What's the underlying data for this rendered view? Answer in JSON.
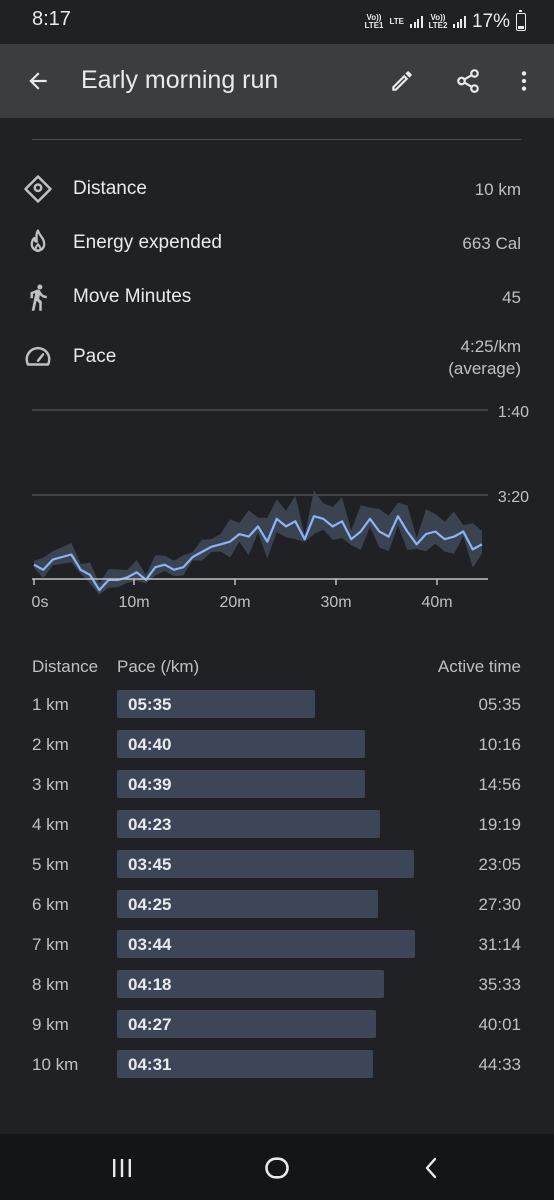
{
  "status_bar": {
    "time": "8:17",
    "net1": "Vo)) LTE1",
    "net_lte": "LTE",
    "net2": "Vo)) LTE2",
    "battery": "17%"
  },
  "app_bar": {
    "title": "Early morning run",
    "icons": [
      "back-arrow-icon",
      "edit-pencil-icon",
      "share-icon",
      "more-vert-icon"
    ]
  },
  "stats": [
    {
      "icon": "location-pin-icon",
      "label": "Distance",
      "value": "10 km"
    },
    {
      "icon": "fire-icon",
      "label": "Energy expended",
      "value": "663 Cal"
    },
    {
      "icon": "walking-icon",
      "label": "Move Minutes",
      "value": "45"
    },
    {
      "icon": "speedometer-icon",
      "label": "Pace",
      "value": "4:25/km",
      "sub": "(average)"
    }
  ],
  "chart_data": {
    "type": "line",
    "series": [
      {
        "values": [
          4.7,
          4.8,
          4.6,
          4.55,
          4.5,
          4.8,
          4.9,
          5.2,
          5.0,
          5.0,
          4.95,
          4.85,
          5.0,
          4.75,
          4.7,
          4.8,
          4.75,
          4.55,
          4.45,
          4.35,
          4.3,
          4.25,
          4.1,
          4.15,
          3.95,
          4.25,
          3.8,
          3.95,
          3.85,
          4.2,
          3.75,
          3.8,
          3.95,
          3.85,
          4.2,
          4.05,
          3.8,
          4.05,
          4.15,
          3.75,
          4.05,
          4.3,
          4.1,
          4.05,
          4.2,
          4.15,
          4.05,
          4.4,
          4.3
        ]
      }
    ],
    "x_ticks": [
      "0s",
      "10m",
      "20m",
      "30m",
      "40m"
    ],
    "y_ticks": [
      "1:40",
      "3:20"
    ],
    "xlim": [
      0,
      45
    ],
    "y_reversed": true
  },
  "colors": {
    "line": "#8ab4f8",
    "band": "#3c4350",
    "bar": "#3d4657",
    "background": "#202124",
    "appbar": "#3c3d40"
  },
  "splits": {
    "headers": {
      "distance": "Distance",
      "pace": "Pace (/km)",
      "time": "Active time"
    },
    "rows": [
      {
        "distance": "1 km",
        "pace": "05:35",
        "time": "05:35"
      },
      {
        "distance": "2 km",
        "pace": "04:40",
        "time": "10:16"
      },
      {
        "distance": "3 km",
        "pace": "04:39",
        "time": "14:56"
      },
      {
        "distance": "4 km",
        "pace": "04:23",
        "time": "19:19"
      },
      {
        "distance": "5 km",
        "pace": "03:45",
        "time": "23:05"
      },
      {
        "distance": "6 km",
        "pace": "04:25",
        "time": "27:30"
      },
      {
        "distance": "7 km",
        "pace": "03:44",
        "time": "31:14"
      },
      {
        "distance": "8 km",
        "pace": "04:18",
        "time": "35:33"
      },
      {
        "distance": "9 km",
        "pace": "04:27",
        "time": "40:01"
      },
      {
        "distance": "10 km",
        "pace": "04:31",
        "time": "44:33"
      }
    ]
  },
  "nav_bar": {
    "icons": [
      "recent-apps-icon",
      "home-icon",
      "back-icon"
    ]
  }
}
